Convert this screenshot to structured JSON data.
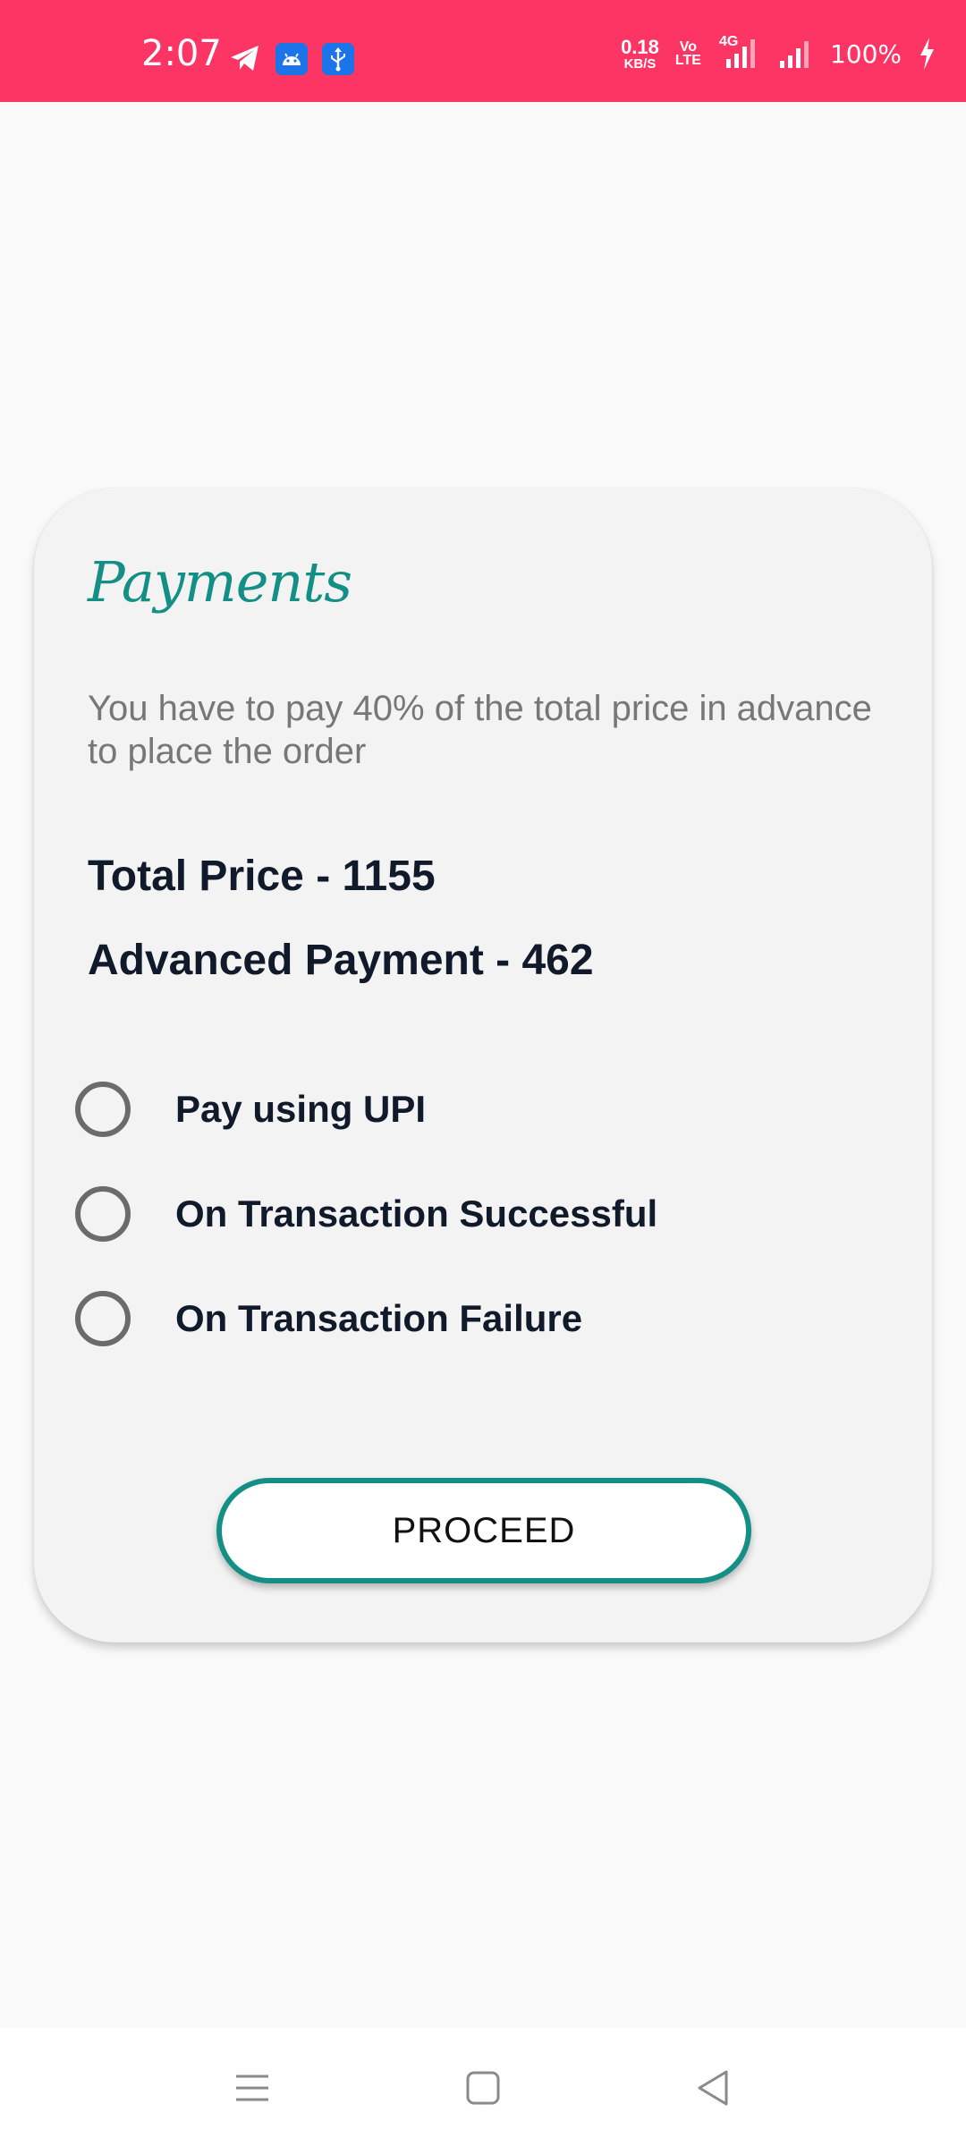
{
  "status_bar": {
    "time": "2:07",
    "net_speed_value": "0.18",
    "net_speed_unit": "KB/S",
    "volte_top": "Vo",
    "volte_bottom": "LTE",
    "network_type": "4G",
    "battery": "100%",
    "icons": [
      "telegram-icon",
      "android-icon",
      "usb-icon",
      "signal-icon",
      "battery-charging-icon"
    ],
    "background_color": "#fc3564"
  },
  "card": {
    "title": "Payments",
    "description": "You have to pay 40% of the total price in advance to place the order",
    "total_price": "Total Price - 1155",
    "advanced_payment": "Advanced Payment - 462",
    "options": [
      {
        "label": "Pay using UPI",
        "selected": false
      },
      {
        "label": "On Transaction Successful",
        "selected": false
      },
      {
        "label": "On Transaction Failure",
        "selected": false
      }
    ],
    "proceed_label": "PROCEED",
    "accent_color": "#138f85"
  },
  "nav_bar": {
    "icons": [
      "menu-icon",
      "home-icon",
      "back-icon"
    ]
  }
}
